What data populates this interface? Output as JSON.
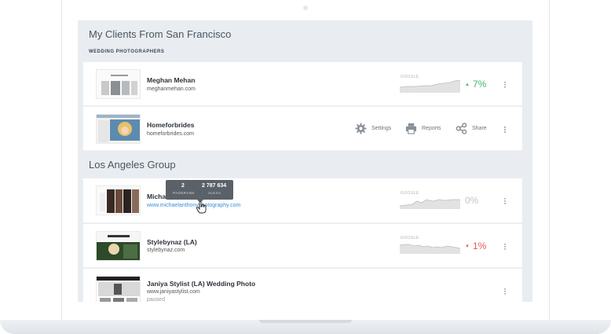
{
  "group1": {
    "title": "My Clients From San Francisco",
    "subtitle": "WEDDING PHOTOGRAPHERS",
    "clients": [
      {
        "name": "Meghan Mehan",
        "url": "meghanmehan.com",
        "metric_label": "GOOGLE",
        "percent": "7%",
        "trend": "up",
        "color": "#3fb86b"
      },
      {
        "name": "Homeforbrides",
        "url": "homeforbrides.com",
        "actions": [
          "Settings",
          "Reports",
          "Share"
        ]
      }
    ]
  },
  "group2": {
    "title": "Los Angeles Group",
    "clients": [
      {
        "name": "Michael Anthony Photography",
        "name_visible": "Micha",
        "url": "www.michaelanthonyphotography.com",
        "metric_label": "GOOGLE",
        "percent": "0%",
        "trend": "flat",
        "color": "#c4c4c4"
      },
      {
        "name": "Stylebynaz (LA)",
        "url": "stylebynaz.com",
        "metric_label": "GOOGLE",
        "percent": "1%",
        "trend": "down",
        "color": "#e45a55"
      },
      {
        "name": "Janiya Stylist (LA) Wedding Photo",
        "url": "www.janiyastylist.com",
        "status": "paused"
      }
    ]
  },
  "tooltip": {
    "pagerank_value": "2",
    "pagerank_label": "PAGERANK",
    "alexa_value": "2 787 634",
    "alexa_label": "ALEXA"
  },
  "icons": {
    "settings": "gear-icon",
    "reports": "printer-icon",
    "share": "share-icon",
    "more": "kebab-icon"
  }
}
